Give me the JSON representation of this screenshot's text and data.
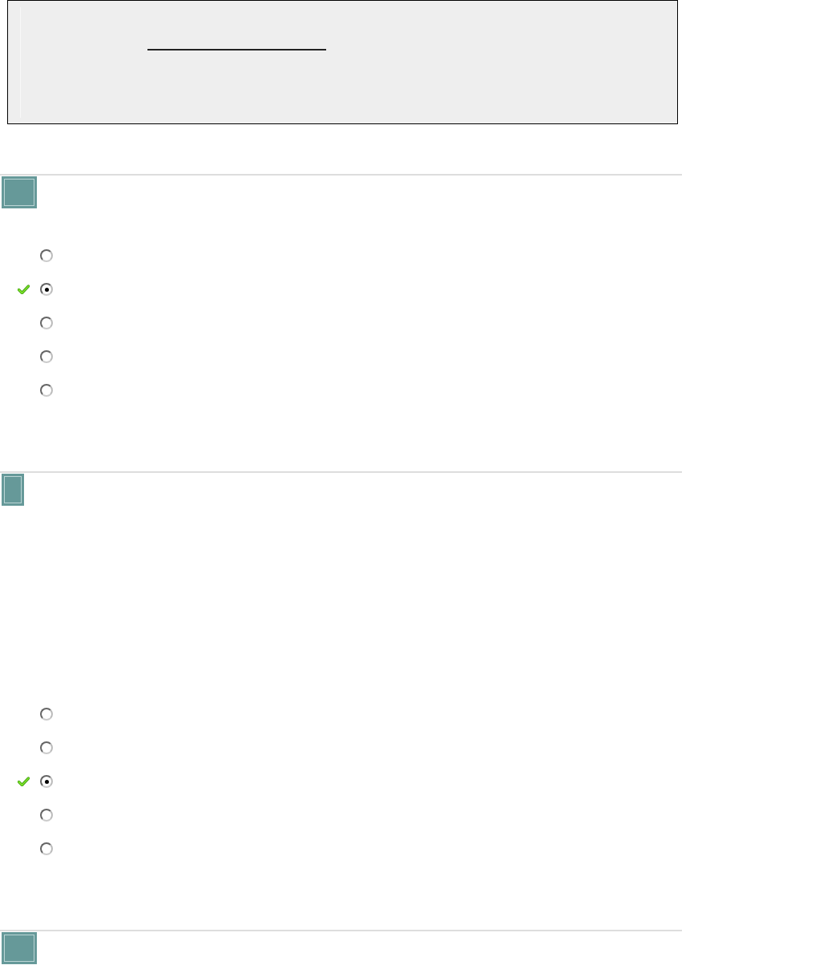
{
  "header": {
    "fill_in_line": true
  },
  "questions": [
    {
      "kind": "standard",
      "options": [
        {
          "selected": false,
          "correct": false
        },
        {
          "selected": true,
          "correct": true
        },
        {
          "selected": false,
          "correct": false
        },
        {
          "selected": false,
          "correct": false
        },
        {
          "selected": false,
          "correct": false
        }
      ]
    },
    {
      "kind": "tall",
      "options": [
        {
          "selected": false,
          "correct": false
        },
        {
          "selected": false,
          "correct": false
        },
        {
          "selected": true,
          "correct": true
        },
        {
          "selected": false,
          "correct": false
        },
        {
          "selected": false,
          "correct": false
        }
      ]
    },
    {
      "kind": "standard"
    }
  ]
}
